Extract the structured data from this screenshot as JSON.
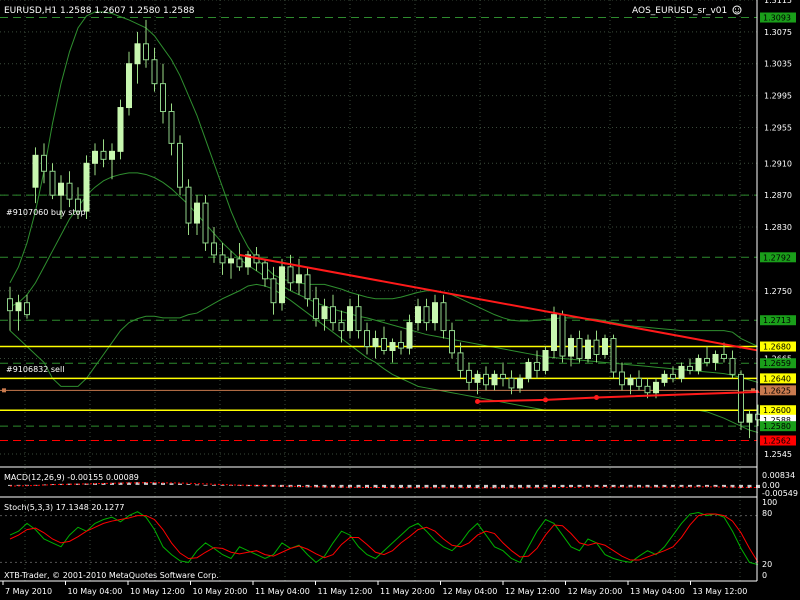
{
  "header": {
    "symbol_line": "EURUSD,H1  1.2588 1.2607 1.2580 1.2588",
    "indicator_name": "AOS_EURUSD_sr_v01"
  },
  "colors": {
    "background": "#000000",
    "bull": "#c8f7b0",
    "bear": "#8fd28a",
    "wick": "#9bdc86",
    "grid": "#3a4a3a",
    "bands": "#2f8f2f",
    "level_green": "#2e8b2e",
    "level_yellow": "#ffff00",
    "level_orange": "#c87a4e",
    "level_red": "#ff0000",
    "macd_hist": "#cccccc",
    "macd_signal": "#ff0000",
    "stoch_main": "#00b000",
    "stoch_signal": "#ff0000",
    "frame": "#ffffff"
  },
  "annotations": {
    "buy_stop": "#9107060 buy stop",
    "sell": "#9106832 sell"
  },
  "price_labels": [
    {
      "text": "1.3115",
      "kind": "tick"
    },
    {
      "text": "1.3093",
      "kind": "green"
    },
    {
      "text": "1.3075",
      "kind": "tick"
    },
    {
      "text": "1.3035",
      "kind": "tick"
    },
    {
      "text": "1.2995",
      "kind": "tick"
    },
    {
      "text": "1.2955",
      "kind": "tick"
    },
    {
      "text": "1.2910",
      "kind": "tick"
    },
    {
      "text": "1.2870",
      "kind": "tick"
    },
    {
      "text": "1.2830",
      "kind": "tick"
    },
    {
      "text": "1.2792",
      "kind": "green"
    },
    {
      "text": "1.2750",
      "kind": "tick"
    },
    {
      "text": "1.2713",
      "kind": "green"
    },
    {
      "text": "1.2680",
      "kind": "yellow"
    },
    {
      "text": "1.2665",
      "kind": "tick"
    },
    {
      "text": "1.2659",
      "kind": "green"
    },
    {
      "text": "1.2640",
      "kind": "yellow"
    },
    {
      "text": "1.2625",
      "kind": "orange"
    },
    {
      "text": "1.2600",
      "kind": "yellow"
    },
    {
      "text": "1.2588",
      "kind": "white"
    },
    {
      "text": "1.2580",
      "kind": "green"
    },
    {
      "text": "1.2562",
      "kind": "red"
    },
    {
      "text": "1.2545",
      "kind": "tick"
    }
  ],
  "macd": {
    "label": "MACD(12,26,9) -0.00155 0.00089",
    "scale": [
      "0.00834",
      "0.00",
      "-0.00549"
    ]
  },
  "stoch": {
    "label": "Stoch(5,3,3) 17.1348 20.1277",
    "scale": [
      "100",
      "80",
      "20",
      "0"
    ]
  },
  "time_labels": [
    "7 May 2010",
    "10 May 04:00",
    "10 May 12:00",
    "10 May 20:00",
    "11 May 04:00",
    "11 May 12:00",
    "11 May 20:00",
    "12 May 04:00",
    "12 May 12:00",
    "12 May 20:00",
    "13 May 04:00",
    "13 May 12:00"
  ],
  "copyright": "XTB-Trader, © 2001-2010 MetaQuotes Software Corp.",
  "chart_data": {
    "type": "candlestick",
    "title": "EURUSD,H1  1.2588 1.2607 1.2580 1.2588",
    "ylim": [
      1.253,
      1.3115
    ],
    "candles": [
      [
        1.274,
        1.2755,
        1.27,
        1.2725
      ],
      [
        1.2725,
        1.2745,
        1.27,
        1.2735
      ],
      [
        1.2735,
        1.2745,
        1.2715,
        1.272
      ],
      [
        1.288,
        1.293,
        1.286,
        1.292
      ],
      [
        1.292,
        1.2935,
        1.2885,
        1.29
      ],
      [
        1.29,
        1.291,
        1.2865,
        1.287
      ],
      [
        1.287,
        1.2895,
        1.284,
        1.2885
      ],
      [
        1.2885,
        1.29,
        1.2855,
        1.2865
      ],
      [
        1.2865,
        1.288,
        1.284,
        1.285
      ],
      [
        1.285,
        1.292,
        1.284,
        1.291
      ],
      [
        1.291,
        1.2935,
        1.2895,
        1.2925
      ],
      [
        1.2925,
        1.294,
        1.2905,
        1.2915
      ],
      [
        1.2915,
        1.2935,
        1.289,
        1.2925
      ],
      [
        1.2925,
        1.299,
        1.2915,
        1.298
      ],
      [
        1.298,
        1.305,
        1.297,
        1.3035
      ],
      [
        1.3035,
        1.3075,
        1.301,
        1.306
      ],
      [
        1.306,
        1.309,
        1.303,
        1.304
      ],
      [
        1.304,
        1.3055,
        1.3,
        1.301
      ],
      [
        1.301,
        1.3035,
        1.296,
        1.2975
      ],
      [
        1.2975,
        1.2985,
        1.292,
        1.2935
      ],
      [
        1.2935,
        1.2945,
        1.287,
        1.288
      ],
      [
        1.288,
        1.289,
        1.282,
        1.2835
      ],
      [
        1.2835,
        1.287,
        1.282,
        1.286
      ],
      [
        1.286,
        1.287,
        1.28,
        1.281
      ],
      [
        1.281,
        1.283,
        1.2785,
        1.2795
      ],
      [
        1.2795,
        1.281,
        1.277,
        1.2785
      ],
      [
        1.2785,
        1.28,
        1.2765,
        1.279
      ],
      [
        1.279,
        1.281,
        1.2775,
        1.278
      ],
      [
        1.278,
        1.28,
        1.277,
        1.2795
      ],
      [
        1.2795,
        1.2805,
        1.2775,
        1.2785
      ],
      [
        1.2785,
        1.279,
        1.2755,
        1.2765
      ],
      [
        1.2765,
        1.278,
        1.272,
        1.2735
      ],
      [
        1.2735,
        1.279,
        1.2725,
        1.278
      ],
      [
        1.278,
        1.2795,
        1.275,
        1.276
      ],
      [
        1.276,
        1.279,
        1.2745,
        1.277
      ],
      [
        1.277,
        1.278,
        1.273,
        1.274
      ],
      [
        1.274,
        1.2755,
        1.2705,
        1.2715
      ],
      [
        1.2715,
        1.274,
        1.27,
        1.273
      ],
      [
        1.273,
        1.2745,
        1.27,
        1.271
      ],
      [
        1.271,
        1.2725,
        1.2685,
        1.27
      ],
      [
        1.27,
        1.274,
        1.269,
        1.273
      ],
      [
        1.273,
        1.2745,
        1.269,
        1.27
      ],
      [
        1.27,
        1.271,
        1.267,
        1.268
      ],
      [
        1.268,
        1.27,
        1.2665,
        1.269
      ],
      [
        1.269,
        1.2705,
        1.267,
        1.2675
      ],
      [
        1.2675,
        1.269,
        1.266,
        1.2685
      ],
      [
        1.2685,
        1.27,
        1.267,
        1.2678
      ],
      [
        1.2678,
        1.272,
        1.267,
        1.271
      ],
      [
        1.271,
        1.274,
        1.27,
        1.273
      ],
      [
        1.273,
        1.274,
        1.27,
        1.271
      ],
      [
        1.271,
        1.2745,
        1.27,
        1.2735
      ],
      [
        1.2735,
        1.2745,
        1.269,
        1.27
      ],
      [
        1.27,
        1.271,
        1.2665,
        1.2672
      ],
      [
        1.2672,
        1.2685,
        1.264,
        1.265
      ],
      [
        1.265,
        1.266,
        1.2625,
        1.2635
      ],
      [
        1.2635,
        1.265,
        1.262,
        1.2645
      ],
      [
        1.2645,
        1.2655,
        1.2625,
        1.2632
      ],
      [
        1.2632,
        1.265,
        1.2625,
        1.2645
      ],
      [
        1.2645,
        1.266,
        1.263,
        1.264
      ],
      [
        1.264,
        1.265,
        1.262,
        1.2628
      ],
      [
        1.2628,
        1.2645,
        1.2622,
        1.264
      ],
      [
        1.264,
        1.2665,
        1.2635,
        1.266
      ],
      [
        1.266,
        1.2675,
        1.264,
        1.265
      ],
      [
        1.265,
        1.268,
        1.2645,
        1.2675
      ],
      [
        1.2675,
        1.273,
        1.2665,
        1.272
      ],
      [
        1.272,
        1.2725,
        1.266,
        1.2668
      ],
      [
        1.2668,
        1.2695,
        1.2655,
        1.269
      ],
      [
        1.269,
        1.27,
        1.266,
        1.2665
      ],
      [
        1.2665,
        1.2695,
        1.266,
        1.2688
      ],
      [
        1.2688,
        1.27,
        1.266,
        1.267
      ],
      [
        1.267,
        1.2695,
        1.2665,
        1.269
      ],
      [
        1.269,
        1.2695,
        1.264,
        1.2648
      ],
      [
        1.2648,
        1.266,
        1.2625,
        1.2632
      ],
      [
        1.2632,
        1.2645,
        1.262,
        1.264
      ],
      [
        1.264,
        1.265,
        1.2625,
        1.263
      ],
      [
        1.263,
        1.264,
        1.2615,
        1.2622
      ],
      [
        1.2622,
        1.264,
        1.2615,
        1.2635
      ],
      [
        1.2635,
        1.265,
        1.263,
        1.2645
      ],
      [
        1.2645,
        1.2655,
        1.2635,
        1.264
      ],
      [
        1.264,
        1.266,
        1.2635,
        1.2655
      ],
      [
        1.2655,
        1.2665,
        1.2645,
        1.265
      ],
      [
        1.265,
        1.267,
        1.2645,
        1.2665
      ],
      [
        1.2665,
        1.268,
        1.2655,
        1.266
      ],
      [
        1.266,
        1.2675,
        1.265,
        1.267
      ],
      [
        1.267,
        1.2685,
        1.266,
        1.2665
      ],
      [
        1.2665,
        1.2675,
        1.264,
        1.2645
      ],
      [
        1.2645,
        1.265,
        1.2575,
        1.2585
      ],
      [
        1.2585,
        1.26,
        1.2565,
        1.2595
      ],
      [
        1.2595,
        1.2607,
        1.258,
        1.2588
      ]
    ],
    "levels": [
      {
        "price": 1.3093,
        "style": "green"
      },
      {
        "price": 1.287,
        "style": "green"
      },
      {
        "price": 1.2792,
        "style": "green"
      },
      {
        "price": 1.2713,
        "style": "green"
      },
      {
        "price": 1.268,
        "style": "yellow"
      },
      {
        "price": 1.2659,
        "style": "green"
      },
      {
        "price": 1.264,
        "style": "yellow"
      },
      {
        "price": 1.2625,
        "style": "orange"
      },
      {
        "price": 1.26,
        "style": "yellow"
      },
      {
        "price": 1.258,
        "style": "green"
      },
      {
        "price": 1.2562,
        "style": "red"
      }
    ],
    "trendline": {
      "from": [
        27,
        1.2795
      ],
      "to": [
        88,
        1.2675
      ]
    },
    "support_line": [
      [
        55,
        1.2611
      ],
      [
        63,
        1.2613
      ],
      [
        69,
        1.2616
      ],
      [
        88,
        1.2623
      ]
    ],
    "upper_band": [
      1.276,
      1.278,
      1.281,
      1.285,
      1.29,
      1.296,
      1.301,
      1.305,
      1.308,
      1.3095,
      1.31,
      1.31,
      1.3098,
      1.3094,
      1.309,
      1.3085,
      1.308,
      1.307,
      1.3055,
      1.304,
      1.302,
      1.2995,
      1.297,
      1.294,
      1.291,
      1.288,
      1.285,
      1.2825,
      1.2805,
      1.279,
      1.278,
      1.277,
      1.2765,
      1.2762,
      1.276,
      1.2758,
      1.2758,
      1.2758,
      1.2755,
      1.2752,
      1.2748,
      1.2745,
      1.2742,
      1.274,
      1.274,
      1.274,
      1.2742,
      1.2745,
      1.2748,
      1.275,
      1.275,
      1.2748,
      1.2745,
      1.274,
      1.2735,
      1.273,
      1.2725,
      1.272,
      1.2716,
      1.2713,
      1.2712,
      1.2712,
      1.2713,
      1.2714,
      1.2715,
      1.2716,
      1.2716,
      1.2716,
      1.2715,
      1.2714,
      1.2712,
      1.271,
      1.2708,
      1.2706,
      1.2705,
      1.2704,
      1.2703,
      1.2702,
      1.2701,
      1.27,
      1.27,
      1.27,
      1.27,
      1.27,
      1.27,
      1.2698,
      1.269,
      1.2685,
      1.268
    ],
    "middle_band": [
      1.273,
      1.2735,
      1.2745,
      1.276,
      1.278,
      1.28,
      1.282,
      1.284,
      1.2855,
      1.287,
      1.288,
      1.2888,
      1.2893,
      1.2896,
      1.2898,
      1.2898,
      1.2896,
      1.2892,
      1.2886,
      1.2878,
      1.2868,
      1.2858,
      1.2846,
      1.2834,
      1.2822,
      1.281,
      1.28,
      1.279,
      1.2782,
      1.2775,
      1.2768,
      1.2762,
      1.2756,
      1.275,
      1.2745,
      1.274,
      1.2735,
      1.2731,
      1.2727,
      1.2724,
      1.2721,
      1.2718,
      1.2716,
      1.2713,
      1.271,
      1.2707,
      1.2704,
      1.2701,
      1.2698,
      1.2695,
      1.2693,
      1.2691,
      1.2689,
      1.2687,
      1.2685,
      1.2683,
      1.2681,
      1.2679,
      1.2677,
      1.2675,
      1.2673,
      1.2671,
      1.2669,
      1.2667,
      1.2666,
      1.2665,
      1.2664,
      1.2663,
      1.2662,
      1.2661,
      1.266,
      1.2659,
      1.2658,
      1.2657,
      1.2656,
      1.2655,
      1.2654,
      1.2653,
      1.2652,
      1.2651,
      1.265,
      1.2649,
      1.2648,
      1.2647,
      1.2646,
      1.2644,
      1.2641,
      1.2638,
      1.2635
    ],
    "lower_band": [
      1.27,
      1.269,
      1.268,
      1.267,
      1.266,
      1.264,
      1.263,
      1.263,
      1.263,
      1.264,
      1.2655,
      1.267,
      1.2685,
      1.27,
      1.271,
      1.2715,
      1.2718,
      1.2718,
      1.2716,
      1.2716,
      1.2716,
      1.272,
      1.2722,
      1.2728,
      1.2734,
      1.274,
      1.2745,
      1.275,
      1.2756,
      1.2758,
      1.2756,
      1.2752,
      1.2745,
      1.2738,
      1.273,
      1.2722,
      1.2714,
      1.2706,
      1.2698,
      1.269,
      1.2682,
      1.2674,
      1.2666,
      1.266,
      1.2652,
      1.2645,
      1.264,
      1.2635,
      1.263,
      1.2628,
      1.2626,
      1.2624,
      1.2622,
      1.262,
      1.2618,
      1.2616,
      1.2614,
      1.2612,
      1.261,
      1.2608,
      1.2606,
      1.2604,
      1.2602,
      1.26,
      1.26,
      1.26,
      1.26,
      1.26,
      1.26,
      1.26,
      1.26,
      1.26,
      1.26,
      1.26,
      1.26,
      1.26,
      1.26,
      1.26,
      1.26,
      1.26,
      1.26,
      1.26,
      1.2598,
      1.2594,
      1.259,
      1.2585,
      1.258,
      1.2575,
      1.2572
    ],
    "macd_ylim": [
      -0.00549,
      0.00834
    ],
    "macd_hist": [
      -0.0005,
      -0.0004,
      -0.0002,
      0.0,
      0.0002,
      0.0004,
      0.0005,
      0.0006,
      0.0006,
      0.0007,
      0.0008,
      0.0009,
      0.001,
      0.0011,
      0.0012,
      0.0013,
      0.0013,
      0.0012,
      0.001,
      0.0008,
      0.0006,
      0.0004,
      0.0002,
      0.0,
      -0.0002,
      -0.0003,
      -0.0004,
      -0.0005,
      -0.0006,
      -0.0007,
      -0.0008,
      -0.0009,
      -0.001,
      -0.0011,
      -0.0011,
      -0.0012,
      -0.0012,
      -0.0013,
      -0.0013,
      -0.0014,
      -0.0014,
      -0.0014,
      -0.0015,
      -0.0015,
      -0.0015,
      -0.0015,
      -0.0015,
      -0.0014,
      -0.0014,
      -0.0014,
      -0.0013,
      -0.0013,
      -0.0014,
      -0.0014,
      -0.0015,
      -0.0016,
      -0.0016,
      -0.0016,
      -0.0015,
      -0.0015,
      -0.0014,
      -0.0014,
      -0.0013,
      -0.0012,
      -0.0012,
      -0.0011,
      -0.0011,
      -0.001,
      -0.001,
      -0.001,
      -0.001,
      -0.0011,
      -0.0011,
      -0.0012,
      -0.0012,
      -0.0012,
      -0.0012,
      -0.0011,
      -0.0011,
      -0.001,
      -0.001,
      -0.001,
      -0.001,
      -0.001,
      -0.0011,
      -0.0013,
      -0.0015,
      -0.0015,
      -0.00155
    ],
    "macd_signal": [
      -0.0006,
      -0.0005,
      -0.0004,
      -0.0003,
      -0.0001,
      0.0001,
      0.0002,
      0.0003,
      0.0004,
      0.0005,
      0.0006,
      0.0007,
      0.0008,
      0.0009,
      0.001,
      0.001,
      0.0011,
      0.0011,
      0.001,
      0.001,
      0.0009,
      0.0008,
      0.0006,
      0.0005,
      0.0003,
      0.0002,
      0.0,
      -0.0001,
      -0.0002,
      -0.0003,
      -0.0004,
      -0.0005,
      -0.0006,
      -0.0007,
      -0.0008,
      -0.0009,
      -0.001,
      -0.001,
      -0.0011,
      -0.0011,
      -0.0012,
      -0.0012,
      -0.0013,
      -0.0013,
      -0.0013,
      -0.0014,
      -0.0014,
      -0.0014,
      -0.0014,
      -0.0014,
      -0.0014,
      -0.0014,
      -0.0014,
      -0.0014,
      -0.0014,
      -0.0014,
      -0.0015,
      -0.0015,
      -0.0015,
      -0.0015,
      -0.0015,
      -0.0014,
      -0.0014,
      -0.0014,
      -0.0013,
      -0.0013,
      -0.0012,
      -0.0012,
      -0.0011,
      -0.0011,
      -0.0011,
      -0.0011,
      -0.0011,
      -0.0011,
      -0.0011,
      -0.0011,
      -0.0011,
      -0.0011,
      -0.0011,
      -0.0011,
      -0.0011,
      -0.001,
      -0.001,
      -0.001,
      -0.0011,
      -0.0011,
      -0.0012,
      -0.0013,
      -0.0013
    ],
    "stoch_main": [
      55,
      60,
      70,
      62,
      50,
      45,
      40,
      55,
      65,
      60,
      70,
      75,
      78,
      72,
      80,
      85,
      78,
      62,
      40,
      30,
      22,
      20,
      35,
      45,
      38,
      30,
      25,
      40,
      35,
      30,
      25,
      30,
      45,
      38,
      42,
      30,
      20,
      28,
      45,
      60,
      55,
      40,
      30,
      25,
      35,
      45,
      55,
      65,
      70,
      60,
      48,
      40,
      35,
      45,
      60,
      70,
      55,
      40,
      35,
      25,
      20,
      40,
      60,
      75,
      70,
      55,
      40,
      35,
      50,
      45,
      30,
      25,
      22,
      20,
      28,
      35,
      30,
      40,
      55,
      70,
      82,
      84,
      80,
      82,
      78,
      60,
      38,
      20,
      17.1348
    ],
    "stoch_signal": [
      50,
      55,
      62,
      64,
      58,
      50,
      45,
      47,
      53,
      60,
      65,
      70,
      73,
      75,
      77,
      80,
      80,
      75,
      62,
      45,
      32,
      25,
      26,
      33,
      39,
      38,
      33,
      31,
      33,
      35,
      30,
      28,
      33,
      38,
      41,
      37,
      31,
      26,
      30,
      43,
      52,
      52,
      43,
      33,
      30,
      35,
      45,
      53,
      62,
      65,
      60,
      50,
      42,
      40,
      45,
      55,
      60,
      57,
      45,
      35,
      27,
      28,
      38,
      55,
      68,
      67,
      57,
      45,
      42,
      45,
      42,
      35,
      28,
      23,
      23,
      27,
      31,
      35,
      40,
      52,
      68,
      80,
      82,
      82,
      80,
      73,
      58,
      38,
      20.1277
    ],
    "stoch_ylim": [
      0,
      100
    ],
    "stoch_levels": [
      80,
      20
    ]
  }
}
